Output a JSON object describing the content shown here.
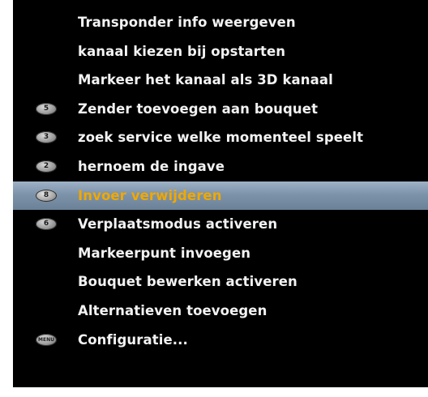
{
  "menu": {
    "items": [
      {
        "key": "",
        "label": "Transponder info weergeven",
        "selected": false,
        "icon": ""
      },
      {
        "key": "",
        "label": "kanaal kiezen bij opstarten",
        "selected": false,
        "icon": ""
      },
      {
        "key": "",
        "label": "Markeer het kanaal als 3D kanaal",
        "selected": false,
        "icon": ""
      },
      {
        "key": "5",
        "label": "Zender toevoegen aan bouquet",
        "selected": false,
        "icon": "key-5-icon"
      },
      {
        "key": "3",
        "label": "zoek service welke momenteel speelt",
        "selected": false,
        "icon": "key-3-icon"
      },
      {
        "key": "2",
        "label": "hernoem de ingave",
        "selected": false,
        "icon": "key-2-icon"
      },
      {
        "key": "8",
        "label": "Invoer verwijderen",
        "selected": true,
        "icon": "key-8-icon"
      },
      {
        "key": "6",
        "label": "Verplaatsmodus activeren",
        "selected": false,
        "icon": "key-6-icon"
      },
      {
        "key": "",
        "label": "Markeerpunt invoegen",
        "selected": false,
        "icon": ""
      },
      {
        "key": "",
        "label": "Bouquet bewerken activeren",
        "selected": false,
        "icon": ""
      },
      {
        "key": "",
        "label": "Alternatieven toevoegen",
        "selected": false,
        "icon": ""
      },
      {
        "key": "MENU",
        "label": "Configuratie...",
        "selected": false,
        "icon": "menu-key-icon"
      }
    ]
  },
  "colors": {
    "background": "#000000",
    "text": "#f2f2f2",
    "selected_text": "#f0a800",
    "selected_bar": "#7d93aa"
  }
}
